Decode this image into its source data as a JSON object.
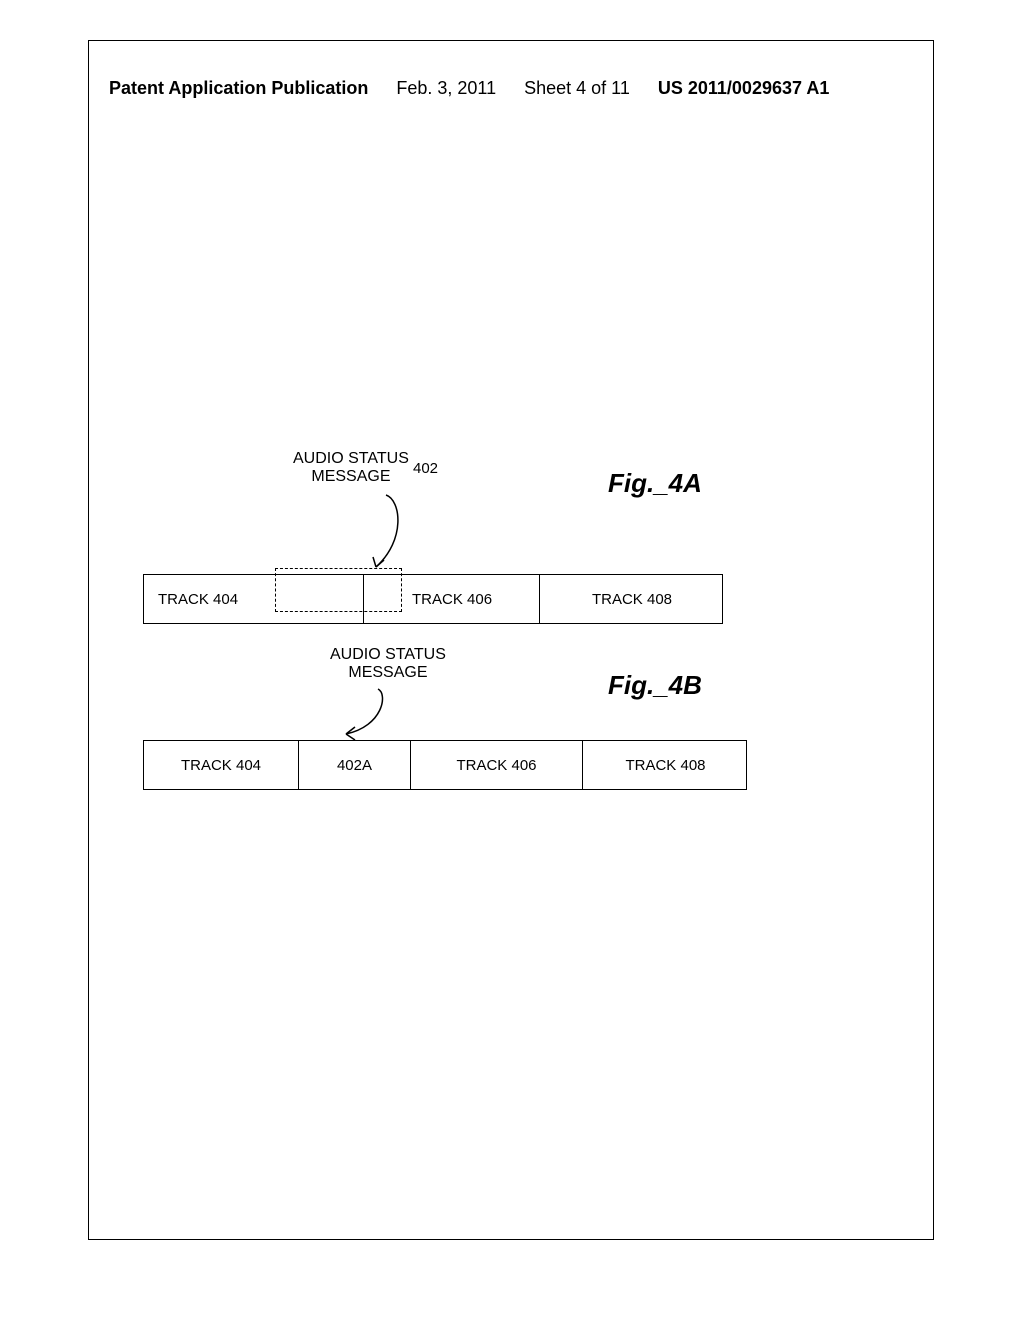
{
  "header": {
    "left": "Patent Application Publication",
    "date": "Feb. 3, 2011",
    "sheet": "Sheet 4 of 11",
    "pubnum": "US 2011/0029637 A1"
  },
  "fig4a": {
    "status_line1": "AUDIO STATUS",
    "status_line2": "MESSAGE",
    "ref402": "402",
    "caption": "Fig._4A",
    "track404": "TRACK 404",
    "track406": "TRACK 406",
    "track408": "TRACK 408"
  },
  "fig4b": {
    "status_line1": "AUDIO STATUS",
    "status_line2": "MESSAGE",
    "caption": "Fig._4B",
    "track404": "TRACK 404",
    "cell402a": "402A",
    "track406": "TRACK 406",
    "track408": "TRACK 408"
  }
}
